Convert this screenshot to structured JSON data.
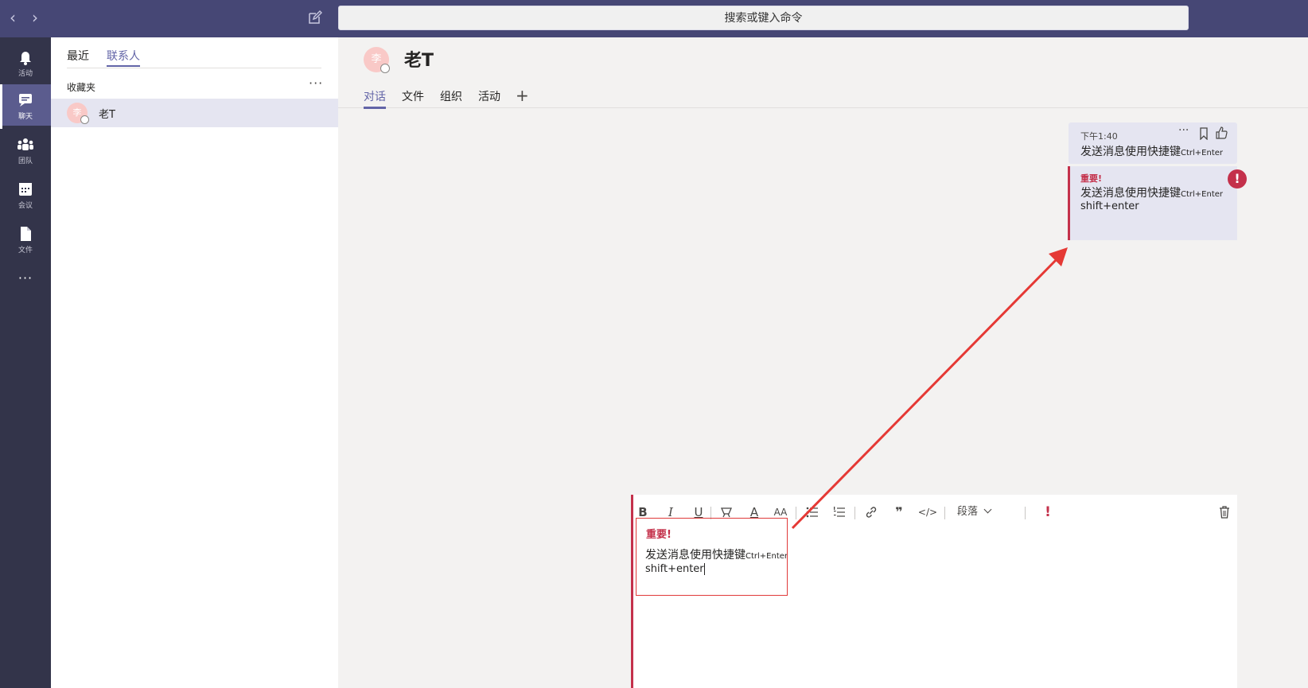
{
  "search": {
    "placeholder": "搜索或键入命令"
  },
  "appbar": {
    "items": [
      {
        "label": "活动",
        "icon": "bell-icon"
      },
      {
        "label": "聊天",
        "icon": "chat-icon"
      },
      {
        "label": "团队",
        "icon": "teams-icon"
      },
      {
        "label": "会议",
        "icon": "calendar-icon"
      },
      {
        "label": "文件",
        "icon": "file-icon"
      }
    ],
    "more": "···"
  },
  "left": {
    "tabs": {
      "recent": "最近",
      "contacts": "联系人"
    },
    "favorites_label": "收藏夹",
    "favorites_more": "···",
    "contact": {
      "name": "老T",
      "avatar_char": "李"
    }
  },
  "chat": {
    "title": "老T",
    "avatar_char": "李",
    "tabs": [
      "对话",
      "文件",
      "组织",
      "活动"
    ],
    "add_tab": "+"
  },
  "messages": [
    {
      "time": "下午1:40",
      "text": "发送消息使用快捷键",
      "shortcut": "Ctrl+Enter"
    },
    {
      "tag": "重要!",
      "text": "发送消息使用快捷键",
      "shortcut": "Ctrl+Enter",
      "line2": "shift+enter"
    }
  ],
  "compose": {
    "toolbar": {
      "bold": "B",
      "italic": "I",
      "underline": "U",
      "font_color": "A",
      "font_size": "AA",
      "quote": "❞",
      "code": "</>",
      "paragraph": "段落",
      "important": "!"
    },
    "tag": "重要!",
    "text": "发送消息使用快捷键",
    "shortcut": "Ctrl+Enter",
    "line2": "shift+enter"
  },
  "colors": {
    "titlebar": "#464775",
    "appbar": "#33344a",
    "accent": "#6264a7",
    "important": "#c4314b",
    "arrow": "#e53935"
  }
}
